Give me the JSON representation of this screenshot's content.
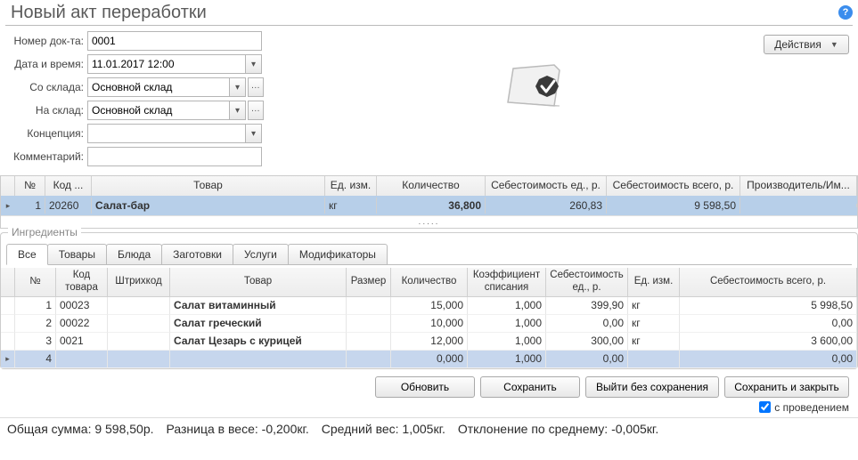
{
  "title": "Новый акт переработки",
  "help_tooltip": "?",
  "actions": {
    "label": "Действия"
  },
  "form": {
    "doc_number_label": "Номер док-та:",
    "doc_number": "0001",
    "datetime_label": "Дата и время:",
    "datetime": "11.01.2017 12:00",
    "from_store_label": "Со склада:",
    "from_store": "Основной склад",
    "to_store_label": "На склад:",
    "to_store": "Основной склад",
    "concept_label": "Концепция:",
    "concept": "",
    "comment_label": "Комментарий:",
    "comment": ""
  },
  "main_grid": {
    "headers": {
      "rowmark": "",
      "num": "№",
      "code": "Код ...",
      "product": "Товар",
      "unit": "Ед. изм.",
      "qty": "Количество",
      "cost_unit": "Себестоимость ед., р.",
      "cost_total": "Себестоимость всего, р.",
      "producer": "Производитель/Им..."
    },
    "row": {
      "num": "1",
      "code": "20260",
      "product": "Салат-бар",
      "unit": "кг",
      "qty": "36,800",
      "cost_unit": "260,83",
      "cost_total": "9 598,50",
      "producer": ""
    }
  },
  "ingredients_legend": "Ингредиенты",
  "tabs": {
    "all": "Все",
    "goods": "Товары",
    "dishes": "Блюда",
    "semis": "Заготовки",
    "services": "Услуги",
    "modifiers": "Модификаторы"
  },
  "ing_headers": {
    "rowmark": "",
    "num": "№",
    "code": "Код товара",
    "barcode": "Штрихкод",
    "product": "Товар",
    "size": "Размер",
    "qty": "Количество",
    "coef": "Коэффициент списания",
    "cost_unit": "Себестоимость ед., р.",
    "unit": "Ед. изм.",
    "cost_total": "Себестоимость всего, р."
  },
  "ing_rows": [
    {
      "num": "1",
      "code": "00023",
      "barcode": "",
      "product": "Салат витаминный",
      "size": "",
      "qty": "15,000",
      "coef": "1,000",
      "cost_unit": "399,90",
      "unit": "кг",
      "cost_total": "5 998,50"
    },
    {
      "num": "2",
      "code": "00022",
      "barcode": "",
      "product": "Салат греческий",
      "size": "",
      "qty": "10,000",
      "coef": "1,000",
      "cost_unit": "0,00",
      "unit": "кг",
      "cost_total": "0,00"
    },
    {
      "num": "3",
      "code": "0021",
      "barcode": "",
      "product": "Салат Цезарь с курицей",
      "size": "",
      "qty": "12,000",
      "coef": "1,000",
      "cost_unit": "300,00",
      "unit": "кг",
      "cost_total": "3 600,00"
    },
    {
      "num": "4",
      "code": "",
      "barcode": "",
      "product": "",
      "size": "",
      "qty": "0,000",
      "coef": "1,000",
      "cost_unit": "0,00",
      "unit": "",
      "cost_total": "0,00",
      "selected": true
    }
  ],
  "buttons": {
    "update": "Обновить",
    "save": "Сохранить",
    "exit_no_save": "Выйти без сохранения",
    "save_close": "Сохранить и закрыть"
  },
  "checkbox": {
    "label": "с проведением",
    "checked": true
  },
  "status": {
    "sum_label": "Общая сумма:",
    "sum_value": "9 598,50р.",
    "wdiff_label": "Разница в весе:",
    "wdiff_value": "-0,200кг.",
    "avg_label": "Средний вес:",
    "avg_value": "1,005кг.",
    "dev_label": "Отклонение по среднему:",
    "dev_value": "-0,005кг."
  }
}
